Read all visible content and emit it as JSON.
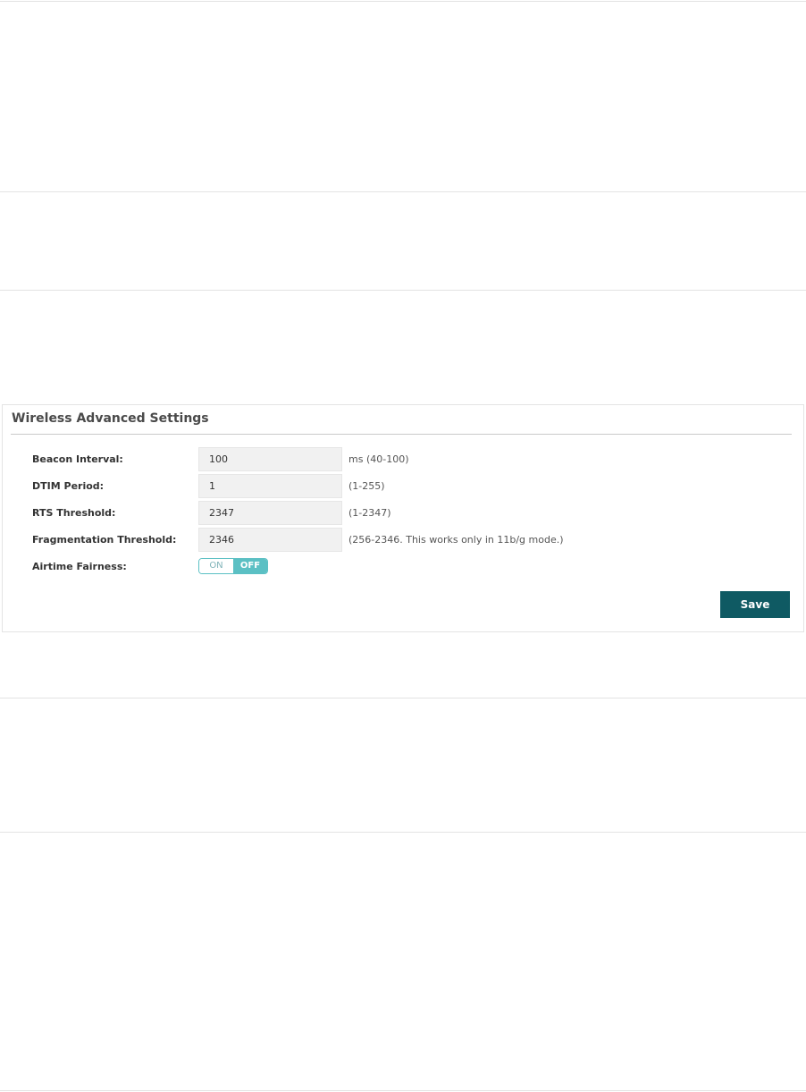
{
  "panel": {
    "title": "Wireless Advanced Settings"
  },
  "fields": [
    {
      "label": "Beacon Interval:",
      "value": "100",
      "hint": "ms (40-100)"
    },
    {
      "label": "DTIM Period:",
      "value": "1",
      "hint": "(1-255)"
    },
    {
      "label": "RTS Threshold:",
      "value": "2347",
      "hint": "(1-2347)"
    },
    {
      "label": "Fragmentation Threshold:",
      "value": "2346",
      "hint": "(256-2346. This works only in 11b/g mode.)"
    }
  ],
  "airtime": {
    "label": "Airtime Fairness:",
    "on_label": "ON",
    "off_label": "OFF",
    "state": "OFF"
  },
  "actions": {
    "save_label": "Save"
  },
  "colors": {
    "accent": "#5bc0c4",
    "save_button": "#0f5a63",
    "input_background": "#f1f1f1"
  }
}
